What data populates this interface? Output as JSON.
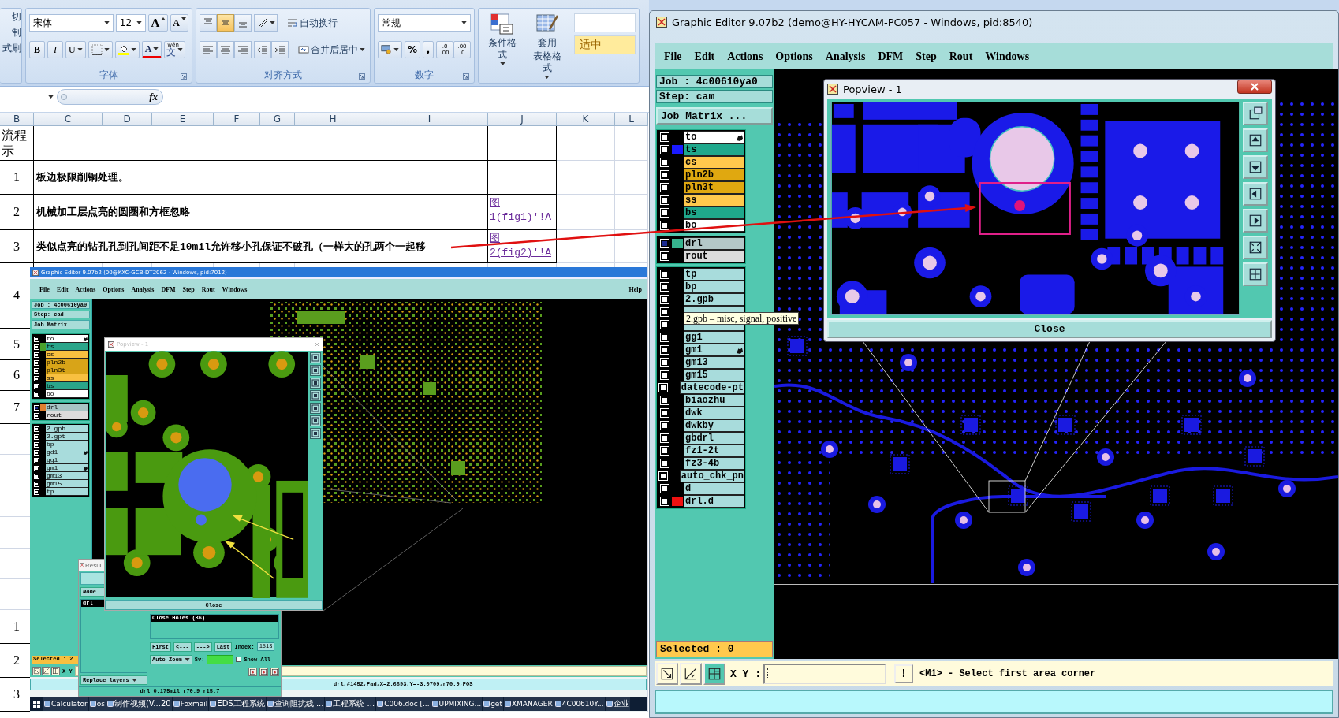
{
  "excel": {
    "ribbon": {
      "clipboard": [
        "切",
        "制",
        "式刷"
      ],
      "font": {
        "face": "宋体",
        "size": "12",
        "grow": "A",
        "shrink": "A",
        "bold": "B",
        "italic": "I",
        "underline": "U",
        "font_color": "A",
        "phonetic_top": "wén",
        "phonetic": "文",
        "label": "字体"
      },
      "alignment": {
        "vertical": [
          {
            "selected": false
          },
          {
            "selected": true
          },
          {
            "selected": false
          }
        ],
        "horizontal": [
          {
            "selected": false
          },
          {
            "selected": false
          },
          {
            "selected": false
          }
        ],
        "wrap": "自动换行",
        "merge": "合并后居中",
        "label": "对齐方式"
      },
      "number": {
        "format": "常规",
        "percent": "%",
        "comma": ",",
        "decimals": [
          {
            "top": ".0",
            "bottom": ".00"
          },
          {
            "top": ".00",
            "bottom": ".0"
          }
        ],
        "label": "数字"
      },
      "styles": {
        "conditional": "条件格式",
        "table": [
          "套用",
          "表格格式"
        ],
        "style_cell": "适中"
      }
    },
    "formula_bar": {
      "fx": "fx"
    },
    "columns": [
      "B",
      "C",
      "D",
      "E",
      "F",
      "G",
      "H",
      "I",
      "J",
      "K",
      "L"
    ],
    "rows": [
      {
        "kind": "table",
        "b": "流程示"
      },
      {
        "kind": "table",
        "number": "1",
        "text": "板边极限削铜处理。"
      },
      {
        "kind": "table",
        "number": "2",
        "text": "机械加工层点亮的圆圈和方框忽略",
        "link": "图1(fig1)'!A"
      },
      {
        "kind": "table",
        "number": "3",
        "text": "类似点亮的钻孔孔到孔间距不足10mil允许移小孔保证不破孔（一样大的孔两个一起移",
        "link": "图2(fig2)'!A"
      },
      {
        "kind": "plain",
        "number": "4"
      },
      {
        "kind": "plain",
        "number": "5"
      },
      {
        "kind": "plain",
        "number": "6"
      },
      {
        "kind": "plain",
        "number": "7"
      },
      {
        "kind": "plain"
      },
      {
        "kind": "plain"
      },
      {
        "kind": "plain"
      },
      {
        "kind": "plain"
      },
      {
        "kind": "plain"
      },
      {
        "kind": "plain"
      },
      {
        "kind": "plain",
        "number": "1"
      },
      {
        "kind": "plain",
        "number": "2"
      },
      {
        "kind": "plain",
        "number": "3"
      }
    ]
  },
  "screenshot": {
    "title": "Graphic Editor 9.07b2 (00@KXC-GCB-DT2062 - Windows, pid:7012)",
    "menu": [
      "File",
      "Edit",
      "Actions",
      "Options",
      "Analysis",
      "DFM",
      "Step",
      "Rout",
      "Windows"
    ],
    "help": "Help",
    "job": "Job : 4c00610ya0",
    "step": "Step: cad",
    "job_matrix": "Job Matrix ...",
    "layer_groups": [
      [
        {
          "name": "to",
          "color": "#ffffff",
          "checked": false,
          "flag": true
        },
        {
          "name": "ts",
          "color": "#2aa58a",
          "checked": false,
          "flag": false,
          "swatch": {
            "color": "#4aa02c"
          }
        },
        {
          "name": "cs",
          "color": "#f8c040",
          "checked": false,
          "flag": false
        },
        {
          "name": "pln2b",
          "color": "#d8a418",
          "checked": false,
          "flag": false
        },
        {
          "name": "pln3t",
          "color": "#d8a418",
          "checked": false,
          "flag": false
        },
        {
          "name": "ss",
          "color": "#f8c040",
          "checked": false,
          "flag": false
        },
        {
          "name": "bs",
          "color": "#2aa58a",
          "checked": false,
          "flag": false
        },
        {
          "name": "bo",
          "color": "#ffffff",
          "checked": false,
          "flag": false
        }
      ],
      [
        {
          "name": "drl",
          "color": "#a8c4c4",
          "checked": true,
          "flag": false,
          "swatch": {
            "color": "#e08030"
          }
        },
        {
          "name": "rout",
          "color": "#dcdcdc",
          "checked": false,
          "flag": false
        }
      ],
      [
        {
          "name": "2.gpb",
          "color": "#a8dcdc",
          "checked": false,
          "flag": false
        },
        {
          "name": "2.gpt",
          "color": "#a8dcdc",
          "checked": false,
          "flag": false
        },
        {
          "name": "bp",
          "color": "#a8dcdc",
          "checked": false,
          "flag": false
        },
        {
          "name": "gd1",
          "color": "#a8dcdc",
          "checked": false,
          "flag": true
        },
        {
          "name": "gg1",
          "color": "#a8dcdc",
          "checked": false,
          "flag": false
        },
        {
          "name": "gm1",
          "color": "#a8dcdc",
          "checked": false,
          "flag": true
        },
        {
          "name": "gm13",
          "color": "#a8dcdc",
          "checked": false,
          "flag": false
        },
        {
          "name": "gm15",
          "color": "#a8dcdc",
          "checked": false,
          "flag": false
        },
        {
          "name": "tp",
          "color": "#a8dcdc",
          "checked": false,
          "flag": false
        }
      ]
    ],
    "selected": "Selected : 2",
    "coordinate_label": "X Y",
    "popview": {
      "title": "Popview - 1",
      "close": "Close"
    },
    "results": {
      "title": "Resul",
      "filter": "None",
      "layers": [
        "drl"
      ],
      "checks": [
        "Close Holes (36)"
      ],
      "first": "First",
      "prev": "<---",
      "next": "--->",
      "last": "Last",
      "index_label": "Index:",
      "index": "1513",
      "zoom": "Auto Zoom",
      "sv": "Sv:",
      "show_all": "Show All",
      "show_all_checked": false,
      "replace": "Replace layers",
      "summary": "drl 0.175mil r70.9 r15.7"
    },
    "status": "drl,#1452,Pad,X=2.6693,Y=-3.0709,r70.9,POS",
    "taskbar": [
      "Calculator",
      "os",
      "制作视频(V...20",
      "Foxmail",
      "EDS工程系统",
      "查询阻抗线 ...",
      "工程系统 ...",
      "C006.doc [...",
      "UPMIXING...",
      "get",
      "XMANAGER",
      "4C00610Y...",
      "企业"
    ]
  },
  "editor": {
    "title": "Graphic Editor 9.07b2 (demo@HY-HYCAM-PC057 - Windows, pid:8540)",
    "menu": [
      "File",
      "Edit",
      "Actions",
      "Options",
      "Analysis",
      "DFM",
      "Step",
      "Rout",
      "Windows"
    ],
    "job": "Job : 4c00610ya0",
    "step": "Step: cam",
    "job_matrix": "Job Matrix ...",
    "layer_groups": [
      [
        {
          "name": "to",
          "color": "#ffffff",
          "checked": false,
          "flag": true
        },
        {
          "name": "ts",
          "color": "#1fa88c",
          "checked": false,
          "flag": false,
          "swatch": {
            "color": "#1a1aff"
          }
        },
        {
          "name": "cs",
          "color": "#ffc94d",
          "checked": false,
          "flag": false
        },
        {
          "name": "pln2b",
          "color": "#e0a810",
          "checked": false,
          "flag": false
        },
        {
          "name": "pln3t",
          "color": "#e0a810",
          "checked": false,
          "flag": false
        },
        {
          "name": "ss",
          "color": "#ffc94d",
          "checked": false,
          "flag": false
        },
        {
          "name": "bs",
          "color": "#1fa88c",
          "checked": false,
          "flag": false
        },
        {
          "name": "bo",
          "color": "#ffffff",
          "checked": false,
          "flag": false
        }
      ],
      [
        {
          "name": "drl",
          "color": "#b4c8c8",
          "checked": true,
          "flag": false,
          "swatch": {
            "color": "#36b48e"
          }
        },
        {
          "name": "rout",
          "color": "#dcdcdc",
          "checked": false,
          "flag": false
        }
      ],
      [
        {
          "name": "tp",
          "color": "#a8dcdc",
          "checked": false,
          "flag": false
        },
        {
          "name": "bp",
          "color": "#a8dcdc",
          "checked": false,
          "flag": false
        },
        {
          "name": "2.gpb",
          "color": "#a8dcdc",
          "checked": false,
          "flag": false
        },
        {
          "checked": false,
          "flag": false,
          "tooltip": "2.gpb – misc, signal, positive"
        },
        {
          "checked": false,
          "flag": false
        },
        {
          "name": "gg1",
          "color": "#a8dcdc",
          "checked": false,
          "flag": false
        },
        {
          "name": "gm1",
          "color": "#a8dcdc",
          "checked": false,
          "flag": true
        },
        {
          "name": "gm13",
          "color": "#a8dcdc",
          "checked": false,
          "flag": false
        },
        {
          "name": "gm15",
          "color": "#a8dcdc",
          "checked": false,
          "flag": false
        },
        {
          "name": "datecode-pt",
          "color": "#a8dcdc",
          "checked": false,
          "flag": false
        },
        {
          "name": "biaozhu",
          "color": "#a8dcdc",
          "checked": false,
          "flag": false
        },
        {
          "name": "dwk",
          "color": "#a8dcdc",
          "checked": false,
          "flag": false
        },
        {
          "name": "dwkby",
          "color": "#a8dcdc",
          "checked": false,
          "flag": false
        },
        {
          "name": "gbdrl",
          "color": "#a8dcdc",
          "checked": false,
          "flag": false
        },
        {
          "name": "fz1-2t",
          "color": "#a8dcdc",
          "checked": false,
          "flag": false
        },
        {
          "name": "fz3-4b",
          "color": "#a8dcdc",
          "checked": false,
          "flag": false
        },
        {
          "name": "auto_chk_pn",
          "color": "#a8dcdc",
          "checked": false,
          "flag": false
        },
        {
          "name": "d",
          "color": "#a8dcdc",
          "checked": false,
          "flag": false
        },
        {
          "name": "drl.d",
          "color": "#a8dcdc",
          "checked": false,
          "flag": false,
          "swatch": {
            "color": "#ee1111"
          }
        }
      ]
    ],
    "popview": {
      "title": "Popview - 1",
      "close": "Close"
    },
    "selected": "Selected : 0",
    "coordinate_label": "X Y :",
    "alert": "!",
    "prompt": "<M1> - Select first area corner"
  }
}
